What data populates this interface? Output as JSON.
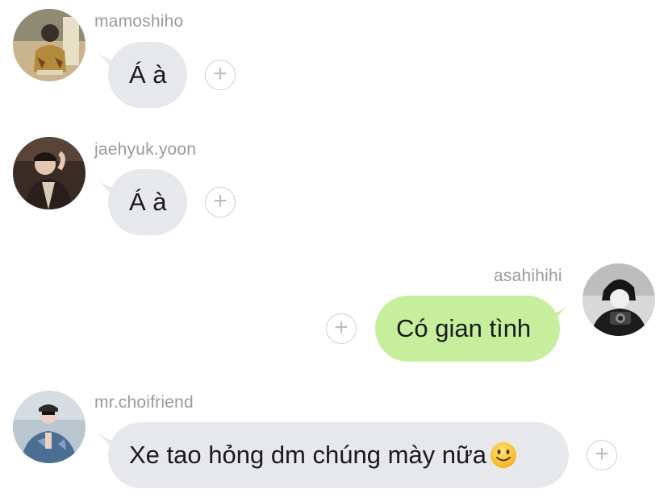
{
  "messages": [
    {
      "sender": "mamoshiho",
      "text": "Á à",
      "direction": "incoming"
    },
    {
      "sender": "jaehyuk.yoon",
      "text": "Á à",
      "direction": "incoming"
    },
    {
      "sender": "asahihihi",
      "text": "Có gian tình",
      "direction": "outgoing"
    },
    {
      "sender": "mr.choifriend",
      "text": "Xe tao hỏng dm chúng mày nữa",
      "direction": "incoming",
      "emoji": "slightly-smiling-face"
    }
  ],
  "actions": {
    "add_reaction_symbol": "+"
  },
  "colors": {
    "incoming_bubble": "#e6e8ec",
    "outgoing_bubble": "#c6ee9c",
    "username": "#9a9a9a",
    "background": "#ffffff"
  }
}
